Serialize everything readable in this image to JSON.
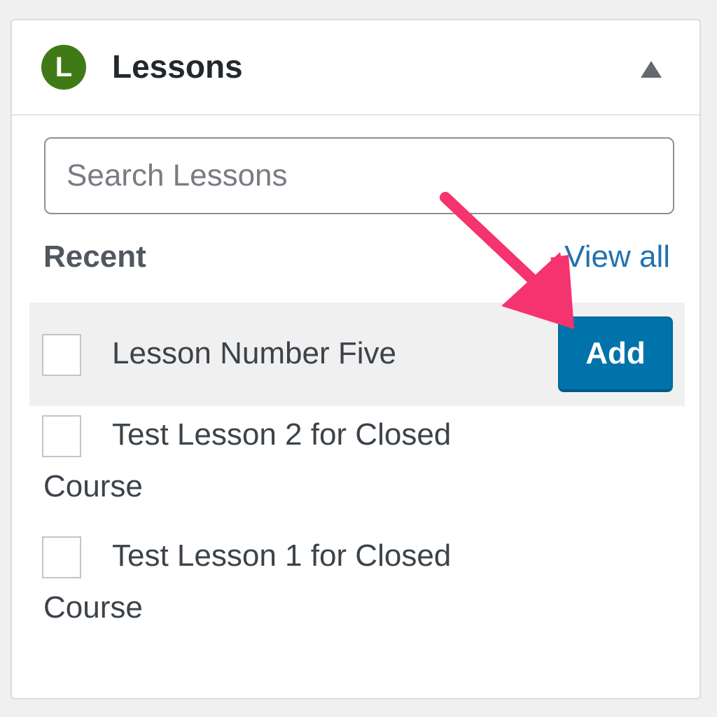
{
  "widget": {
    "logo_letter": "L",
    "title": "Lessons",
    "collapse_icon": "triangle-up-icon"
  },
  "search": {
    "placeholder": "Search Lessons",
    "value": ""
  },
  "recent": {
    "label": "Recent",
    "view_all_label": "View all"
  },
  "items": [
    {
      "line1": "Lesson Number Five",
      "line2": "",
      "checked": false,
      "highlighted": true
    },
    {
      "line1": "Test Lesson 2 for Closed",
      "line2": "Course",
      "checked": false,
      "highlighted": false
    },
    {
      "line1": "Test Lesson 1 for Closed",
      "line2": "Course",
      "checked": false,
      "highlighted": false
    }
  ],
  "add_button": {
    "label": "Add"
  },
  "colors": {
    "logo": "#3f7a17",
    "accent_link": "#2271b1",
    "button": "#0073aa",
    "annotation_arrow": "#f4336f"
  }
}
